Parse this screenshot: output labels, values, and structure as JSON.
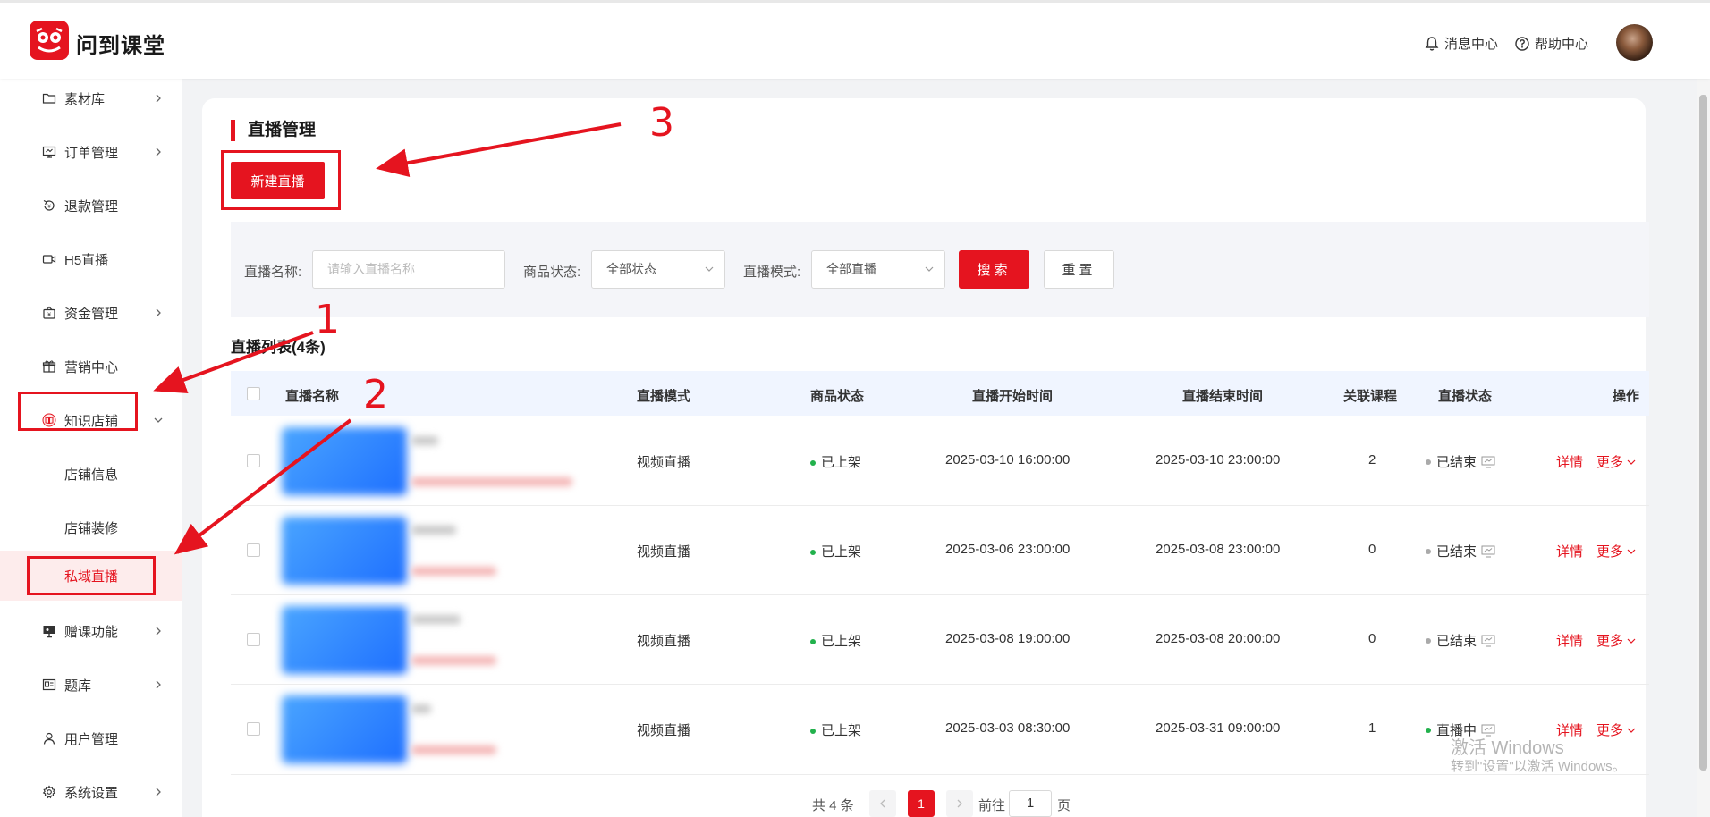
{
  "header": {
    "brand": "问到课堂",
    "notifications": "消息中心",
    "help": "帮助中心"
  },
  "sidebar": {
    "items": [
      {
        "label": "素材库",
        "icon": "folder-icon"
      },
      {
        "label": "订单管理",
        "icon": "monitor-icon"
      },
      {
        "label": "退款管理",
        "icon": "refund-icon"
      },
      {
        "label": "H5直播",
        "icon": "video-icon"
      },
      {
        "label": "资金管理",
        "icon": "wallet-icon"
      },
      {
        "label": "营销中心",
        "icon": "gift-icon"
      },
      {
        "label": "知识店铺",
        "icon": "book-icon"
      },
      {
        "label": "店铺信息"
      },
      {
        "label": "店铺装修"
      },
      {
        "label": "私域直播"
      },
      {
        "label": "赠课功能",
        "icon": "screen-icon"
      },
      {
        "label": "题库",
        "icon": "card-icon"
      },
      {
        "label": "用户管理",
        "icon": "user-icon"
      },
      {
        "label": "系统设置",
        "icon": "settings-icon"
      }
    ]
  },
  "main": {
    "title": "直播管理",
    "new_button": "新建直播",
    "filters": {
      "name_label": "直播名称:",
      "name_placeholder": "请输入直播名称",
      "product_label": "商品状态:",
      "product_value": "全部状态",
      "mode_label": "直播模式:",
      "mode_value": "全部直播",
      "search": "搜索",
      "reset": "重置"
    },
    "list_title": "直播列表(4条)",
    "columns": [
      "直播名称",
      "直播模式",
      "商品状态",
      "直播开始时间",
      "直播结束时间",
      "关联课程",
      "直播状态",
      "操作"
    ],
    "rows": [
      {
        "mode": "视频直播",
        "product": "已上架",
        "start": "2025-03-10 16:00:00",
        "end": "2025-03-10 23:00:00",
        "courses": "2",
        "status": "已结束",
        "detail": "详情",
        "more": "更多"
      },
      {
        "mode": "视频直播",
        "product": "已上架",
        "start": "2025-03-06 23:00:00",
        "end": "2025-03-08 23:00:00",
        "courses": "0",
        "status": "已结束",
        "detail": "详情",
        "more": "更多"
      },
      {
        "mode": "视频直播",
        "product": "已上架",
        "start": "2025-03-08 19:00:00",
        "end": "2025-03-08 20:00:00",
        "courses": "0",
        "status": "已结束",
        "detail": "详情",
        "more": "更多"
      },
      {
        "mode": "视频直播",
        "product": "已上架",
        "start": "2025-03-03 08:30:00",
        "end": "2025-03-31 09:00:00",
        "courses": "1",
        "status": "直播中",
        "detail": "详情",
        "more": "更多"
      }
    ],
    "pagination": {
      "total": "共 4 条",
      "current": "1",
      "goto": "前往",
      "goto_value": "1",
      "unit": "页"
    }
  },
  "watermark": {
    "line1": "激活 Windows",
    "line2": "转到\"设置\"以激活 Windows。"
  },
  "annotations": [
    "1",
    "2",
    "3"
  ],
  "colors": {
    "accent": "#e5141f",
    "green_dot": "#22b14c",
    "gray_dot": "#aaaaaa"
  }
}
